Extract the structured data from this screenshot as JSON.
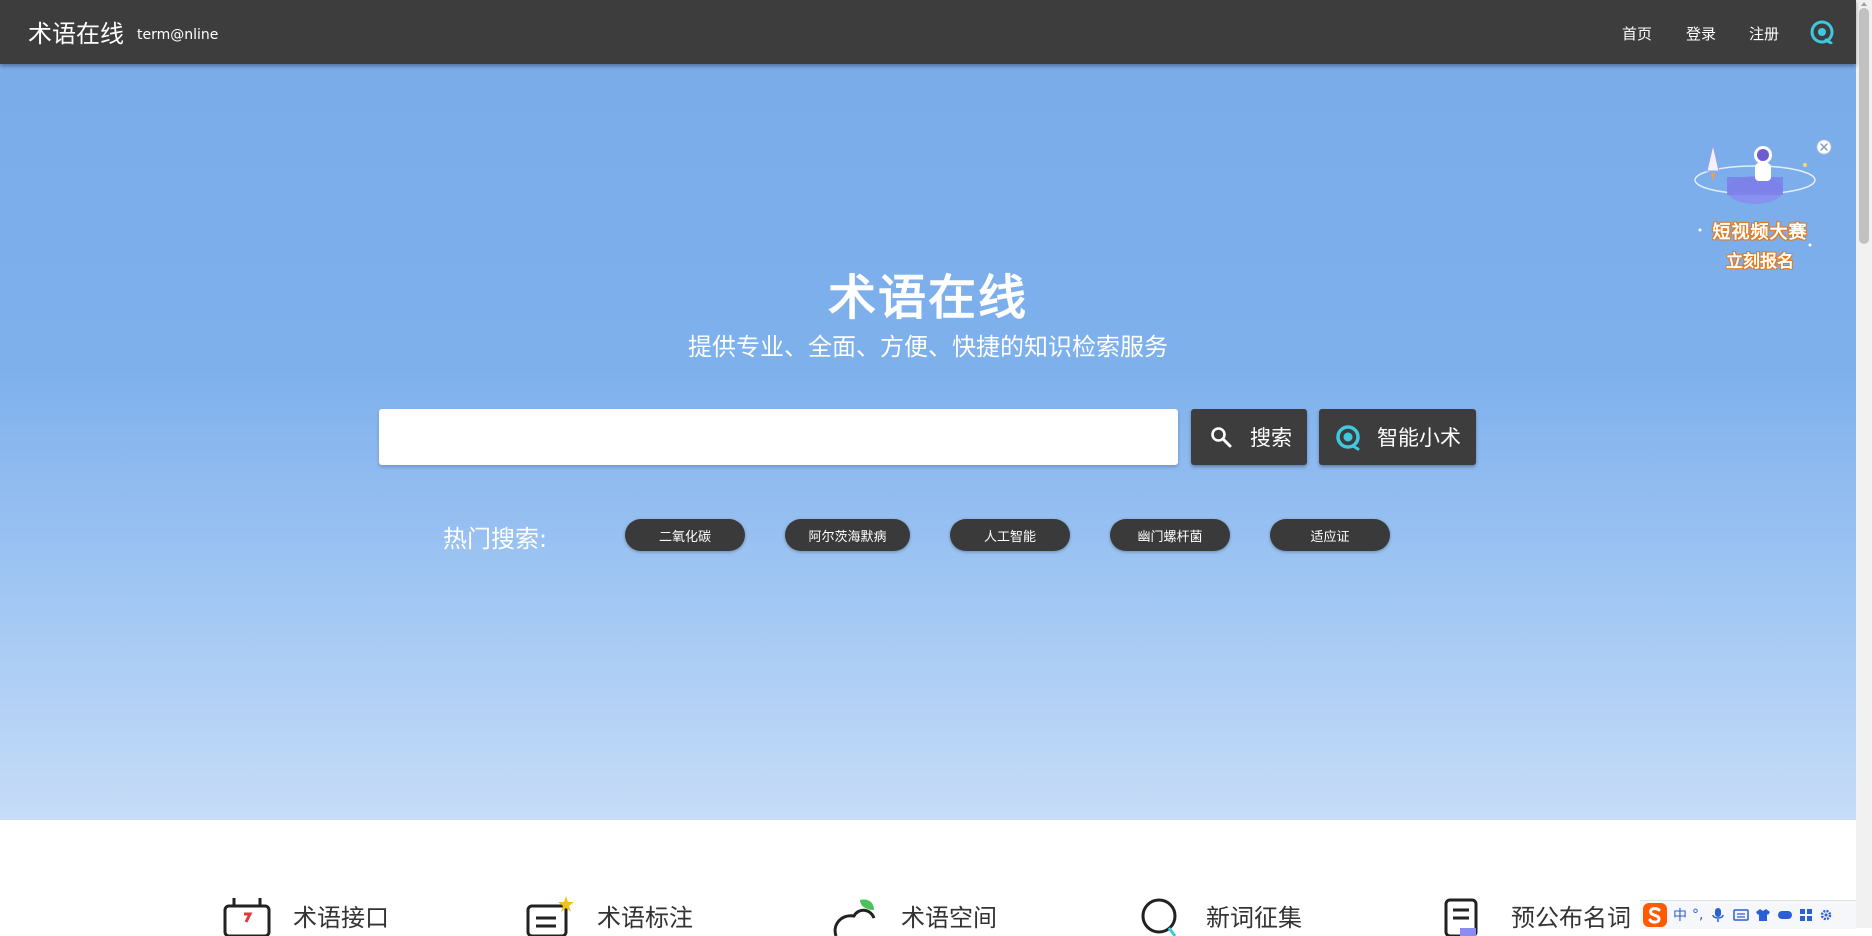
{
  "header": {
    "logo_cn": "术语在线",
    "logo_en": "term@nline",
    "nav": {
      "home": "首页",
      "login": "登录",
      "register": "注册"
    }
  },
  "hero": {
    "title": "术语在线",
    "subtitle": "提供专业、全面、方便、快捷的知识检索服务",
    "search": {
      "value": "",
      "placeholder": ""
    },
    "search_button": "搜索",
    "ai_button": "智能小术",
    "hot_label": "热门搜索:",
    "hot_tags": [
      "二氧化碳",
      "阿尔茨海默病",
      "人工智能",
      "幽门螺杆菌",
      "适应证"
    ]
  },
  "promo": {
    "line1": "短视频大赛",
    "line2": "立刻报名"
  },
  "features": [
    {
      "label": "术语接口",
      "icon": "api-icon"
    },
    {
      "label": "术语标注",
      "icon": "annotate-icon"
    },
    {
      "label": "术语空间",
      "icon": "space-icon"
    },
    {
      "label": "新词征集",
      "icon": "collect-icon"
    },
    {
      "label": "预公布名词",
      "icon": "document-icon"
    }
  ],
  "ime": {
    "mode": "中",
    "punct": "°,"
  },
  "colors": {
    "topbar": "#3d3d3d",
    "hero_top": "#7aacea",
    "hero_bottom": "#c6dcf7",
    "button_dark": "#3d3d3d",
    "accent_cyan": "#3ec9e0",
    "sogou_orange": "#ff5a00"
  }
}
